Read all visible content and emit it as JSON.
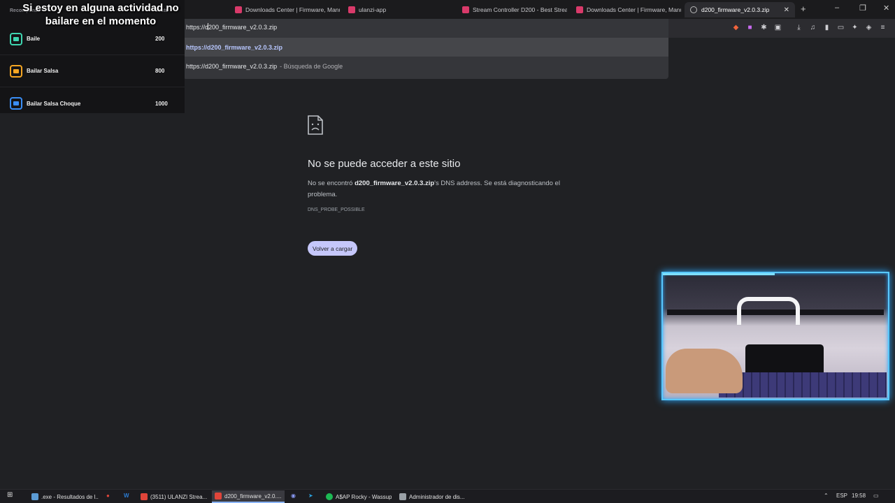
{
  "tabs": [
    {
      "label": "Downloads Center | Firmware, Manu",
      "active": false
    },
    {
      "label": "ulanzi-app",
      "active": false
    },
    {
      "label": "Stream Controller D200 - Best Stream",
      "active": false
    },
    {
      "label": "Downloads Center | Firmware, Manu",
      "active": false
    },
    {
      "label": "d200_firmware_v2.0.3.zip",
      "active": true
    }
  ],
  "window_controls": {
    "minimize": "–",
    "restore": "❐",
    "close": "✕",
    "new_tab": "+",
    "tab_close": "✕"
  },
  "omnibox": {
    "value": "https://d200_firmware_v2.0.3.zip",
    "suggestion_selected": "https://d200_firmware_v2.0.3.zip",
    "suggestion_search_query": "https://d200_firmware_v2.0.3.zip",
    "suggestion_search_suffix": "- Búsqueda de Google"
  },
  "overlay": {
    "caption": "Si estoy en alguna actividad no bailare en el momento",
    "header_left": "Recompensa",
    "header_right": "Costo",
    "rewards": [
      {
        "name": "Baile",
        "cost": "200",
        "color": "#3ed6b0"
      },
      {
        "name": "Bailar Salsa",
        "cost": "800",
        "color": "#f5a623"
      },
      {
        "name": "Bailar Salsa Choque",
        "cost": "1000",
        "color": "#3a8ef6"
      }
    ]
  },
  "error": {
    "title": "No se puede acceder a este sitio",
    "body_prefix": "No se encontró ",
    "body_host": "d200_firmware_v2.0.3.zip",
    "body_suffix": "'s DNS address. Se está diagnosticando el problema.",
    "code": "DNS_PROBE_POSSIBLE",
    "reload_label": "Volver a cargar"
  },
  "taskbar": {
    "items": [
      {
        "label": ".exe - Resultados de l...",
        "active": false,
        "color": "#5b9bd5"
      },
      {
        "label": "(3511) ULANZI Strea...",
        "active": false,
        "color": "#e0453a"
      },
      {
        "label": "d200_firmware_v2.0....",
        "active": true,
        "color": "#e0453a"
      },
      {
        "label": "A$AP Rocky - Wassup",
        "active": false,
        "color": "#1db954"
      },
      {
        "label": "Administrador de dis...",
        "active": false,
        "color": "#9aa0a6"
      }
    ],
    "language": "ESP",
    "time": "19:58"
  },
  "colors": {
    "accent": "#c5c7fa",
    "camera_border": "#59c8ff",
    "tab_favicon": "#d93a6a"
  }
}
